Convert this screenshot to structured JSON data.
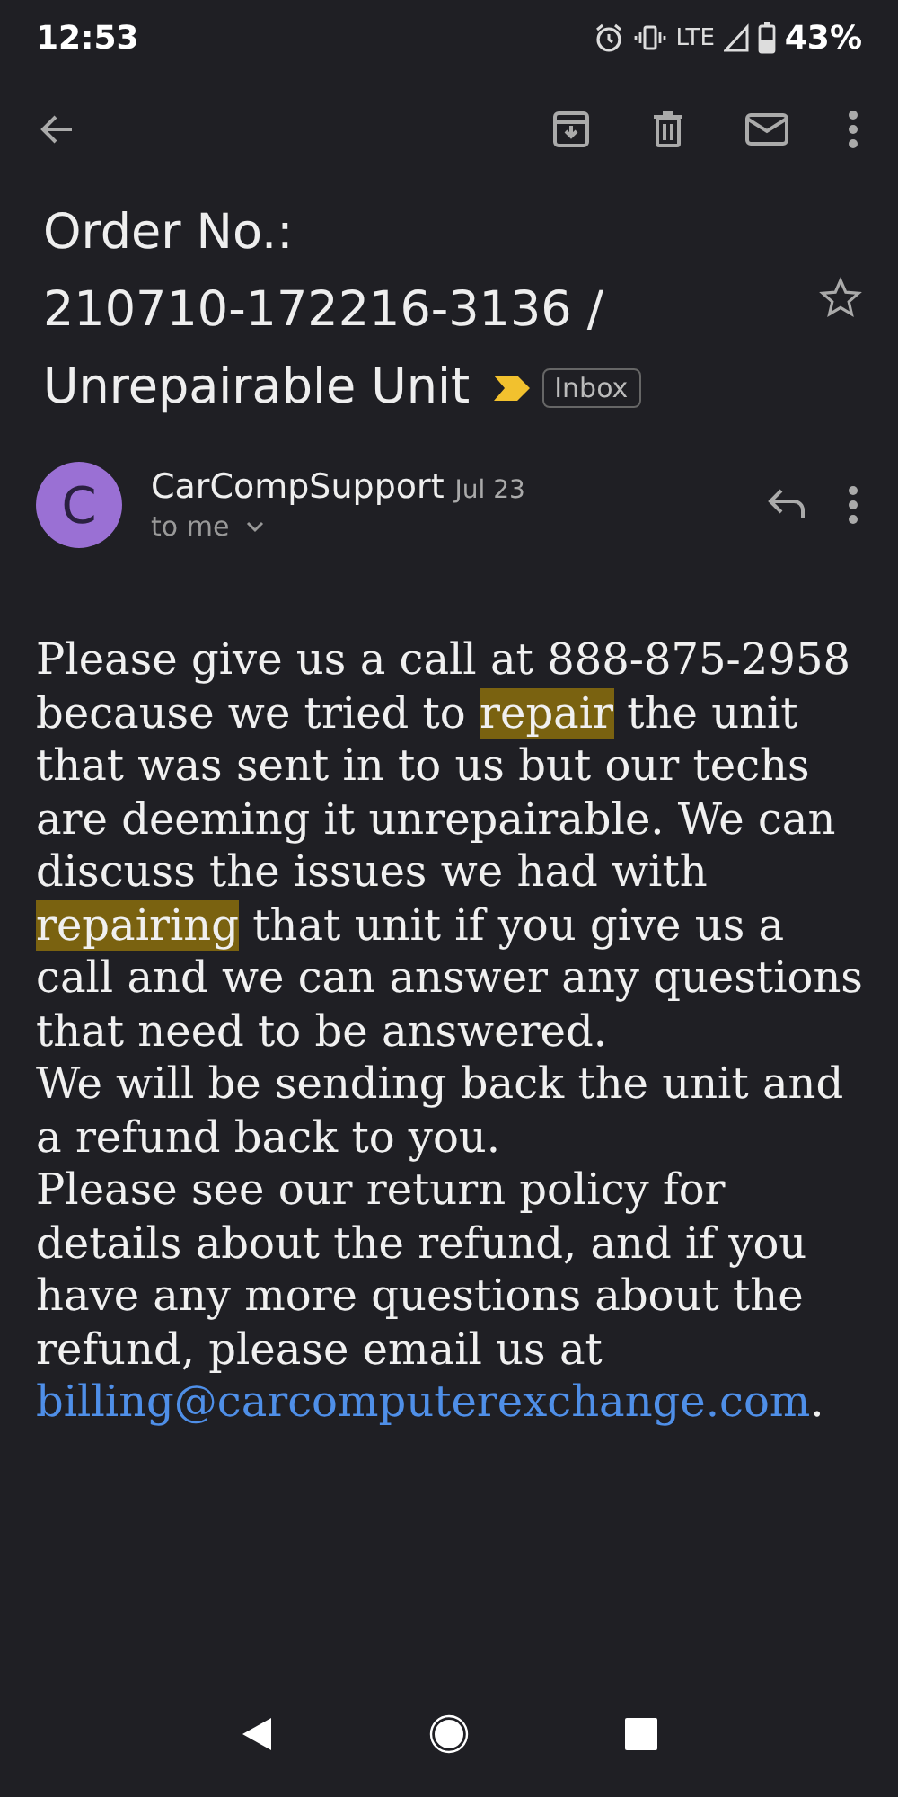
{
  "status_bar": {
    "time": "12:53",
    "network": "LTE",
    "battery": "43%"
  },
  "subject": {
    "lines": [
      "Order No.:",
      "210710-172216-3136 /",
      "Unrepairable Unit"
    ],
    "important": true,
    "label": "Inbox",
    "starred": false
  },
  "message": {
    "avatar": "C",
    "sender": "CarCompSupport",
    "date": "Jul 23",
    "recipient": "to me",
    "paragraphs": [
      [
        {
          "kind": "text",
          "text": "Please give us a call at 888-875-2958 because we tried to "
        },
        {
          "kind": "highlight",
          "text": "repair"
        },
        {
          "kind": "text",
          "text": " the unit that was sent in to us but our techs are deeming it unrepairable. We can discuss the issues we had with "
        },
        {
          "kind": "highlight",
          "text": "repairing"
        },
        {
          "kind": "text",
          "text": " that unit if you give us a call and we can answer any questions that need to be answered."
        }
      ],
      [
        {
          "kind": "text",
          "text": "We will be sending back the unit and a refund back to you."
        }
      ],
      [
        {
          "kind": "text",
          "text": "Please see our return policy for details about the refund, and if you have any more questions about the refund, please email us at "
        },
        {
          "kind": "link",
          "text": "billing@carcomputerexchange.com"
        },
        {
          "kind": "text",
          "text": "."
        }
      ]
    ]
  }
}
